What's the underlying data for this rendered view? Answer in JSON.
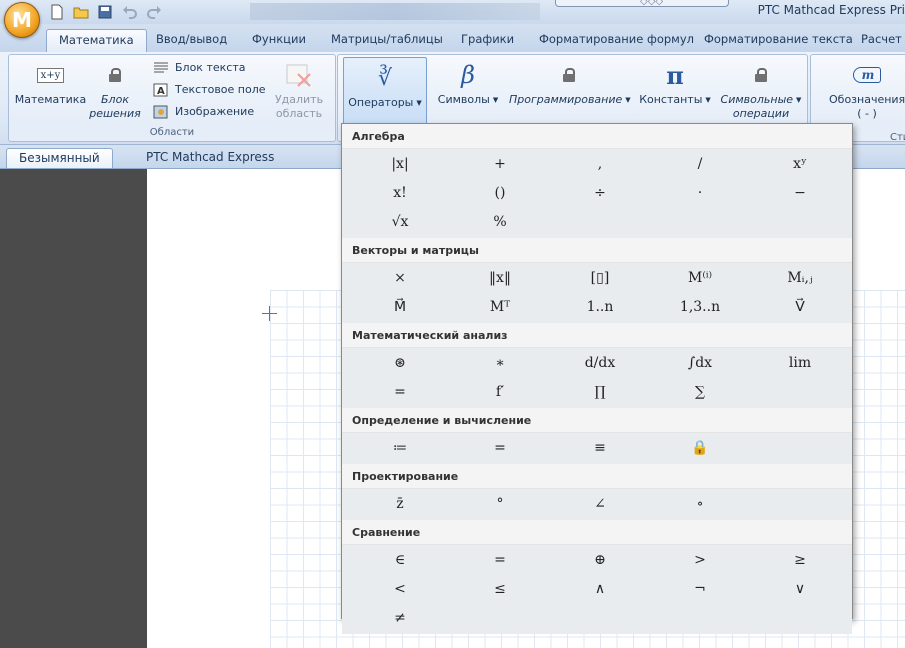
{
  "titlebar": {
    "app_button": "M",
    "title": "PTC Mathcad Express Pri",
    "decor_glyph": "◇◇◇"
  },
  "tabs": [
    "Математика",
    "Ввод/вывод",
    "Функции",
    "Матрицы/таблицы",
    "Графики",
    "Форматирование формул",
    "Форматирование текста",
    "Расчет"
  ],
  "ribbon": {
    "oblasti": {
      "label": "Области",
      "matematika": "Математика",
      "blok_resheniya_1": "Блок",
      "blok_resheniya_2": "решения",
      "blok_teksta": "Блок текста",
      "tekstovoe_pole": "Текстовое поле",
      "izobrazhenie": "Изображение",
      "udalit_1": "Удалить",
      "udalit_2": "область",
      "math_icon_text": "x+y"
    },
    "operators": "Операторы",
    "operators_icon": "∛",
    "symbols": "Символы",
    "symbols_icon": "β",
    "programming": "Программирование",
    "constants": "Константы",
    "constants_icon": "π",
    "symbolic_1": "Символьные",
    "symbolic_2": "операции",
    "oboznacheniya": "Обозначения",
    "oboznacheniya_sub": "( - )",
    "oboznacheniya_icon": "m",
    "right_group_fragment": "Сти"
  },
  "doc_tabs": [
    "Безымянный",
    "PTC Mathcad Express"
  ],
  "panel": {
    "sections": [
      {
        "title": "Алгебра",
        "rows": [
          [
            "|x|",
            "+",
            ",",
            "/",
            "xʸ"
          ],
          [
            "x!",
            "()",
            "÷",
            "·",
            "−"
          ],
          [
            "√x",
            "%"
          ]
        ]
      },
      {
        "title": "Векторы и матрицы",
        "rows": [
          [
            "×",
            "‖x‖",
            "[▯]",
            "M⁽ⁱ⁾",
            "Mᵢ,ⱼ"
          ],
          [
            "M⃗",
            "Mᵀ",
            "1..n",
            "1,3..n",
            "V⃗"
          ]
        ]
      },
      {
        "title": "Математический анализ",
        "rows": [
          [
            "⊛",
            "∗",
            "d/dx",
            "∫dx",
            "lim"
          ],
          [
            "=",
            "f′",
            "∏",
            "∑"
          ]
        ]
      },
      {
        "title": "Определение и вычисление",
        "rows": [
          [
            "≔",
            "=",
            "≡",
            "🔒"
          ]
        ]
      },
      {
        "title": "Проектирование",
        "rows": [
          [
            "z̄",
            "°",
            "∠",
            "∘"
          ]
        ]
      },
      {
        "title": "Сравнение",
        "rows": [
          [
            "∈",
            "=",
            "⊕",
            ">",
            "≥"
          ],
          [
            "<",
            "≤",
            "∧",
            "¬",
            "∨"
          ],
          [
            "≠"
          ]
        ]
      }
    ]
  }
}
